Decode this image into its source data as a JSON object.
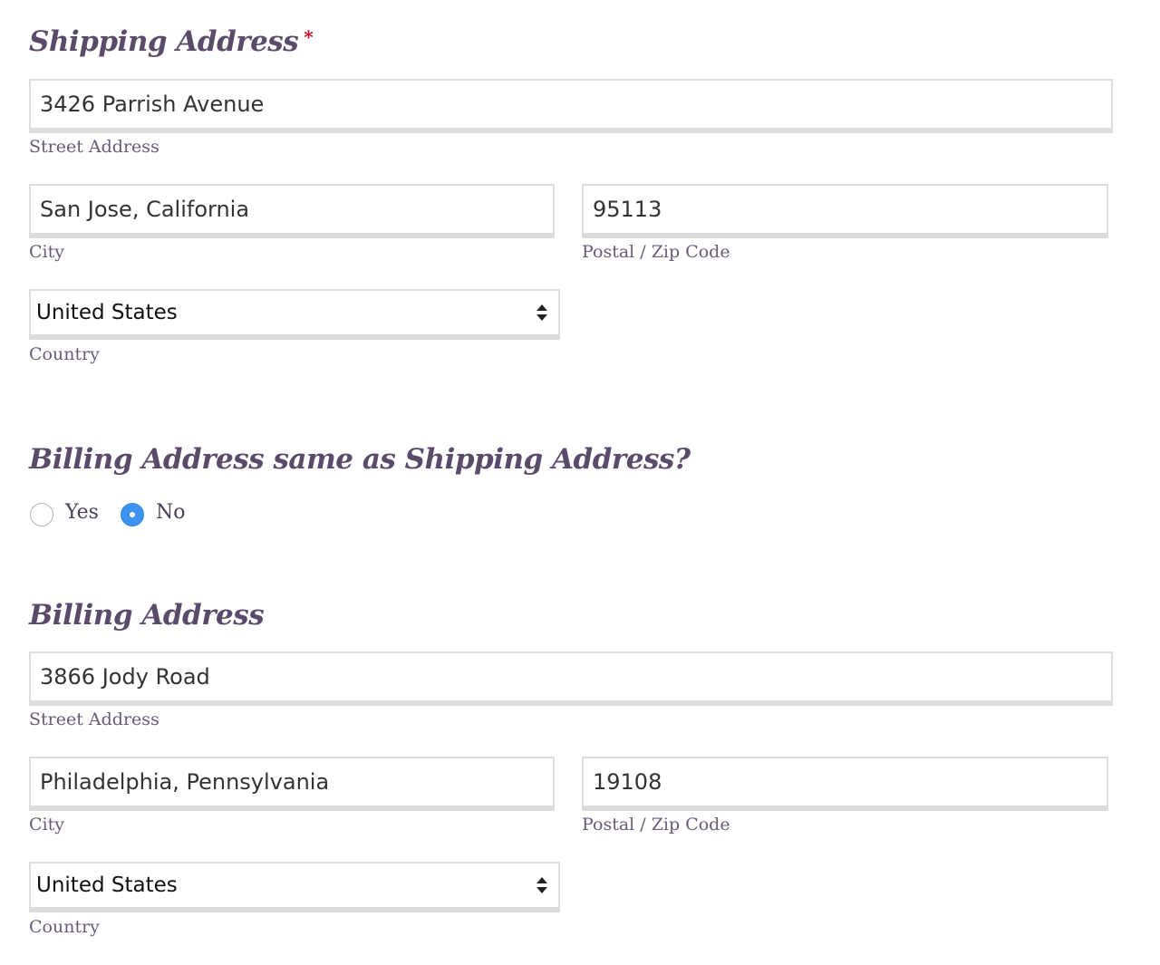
{
  "shipping": {
    "title": "Shipping Address",
    "required_marker": "*",
    "street": {
      "value": "3426 Parrish Avenue",
      "label": "Street Address"
    },
    "city": {
      "value": "San Jose, California",
      "label": "City"
    },
    "postal": {
      "value": "95113",
      "label": "Postal / Zip Code"
    },
    "country": {
      "value": "United States",
      "label": "Country"
    }
  },
  "same_question": {
    "title": "Billing Address same as Shipping Address?",
    "options": [
      {
        "label": "Yes",
        "selected": false
      },
      {
        "label": "No",
        "selected": true
      }
    ]
  },
  "billing": {
    "title": "Billing Address",
    "street": {
      "value": "3866 Jody Road",
      "label": "Street Address"
    },
    "city": {
      "value": "Philadelphia, Pennsylvania",
      "label": "City"
    },
    "postal": {
      "value": "19108",
      "label": "Postal / Zip Code"
    },
    "country": {
      "value": "United States",
      "label": "Country"
    }
  },
  "colors": {
    "heading": "#5b4b6b",
    "label": "#6a5a78",
    "required": "#d0021b",
    "radio_selected": "#3d93ee",
    "field_border": "#dcdcdc"
  }
}
